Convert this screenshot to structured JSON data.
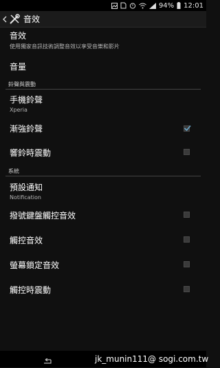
{
  "status_bar": {
    "battery_level": "94%",
    "time": "12:01"
  },
  "action_bar": {
    "title": "音效"
  },
  "items": [
    {
      "title": "音效",
      "subtitle": "使用獨家音訊技術調整音效以享受音樂和影片"
    },
    {
      "title": "音量"
    },
    {
      "section": "鈴聲與震動"
    },
    {
      "title": "手機鈴聲",
      "subtitle": "Xperia"
    },
    {
      "title": "漸強鈴聲",
      "checked": true
    },
    {
      "title": "響鈴時震動",
      "checked": false
    },
    {
      "section": "系統"
    },
    {
      "title": "預設通知",
      "subtitle": "Notification"
    },
    {
      "title": "撥號鍵盤觸控音效",
      "checked": false
    },
    {
      "title": "觸控音效",
      "checked": false
    },
    {
      "title": "螢幕鎖定音效",
      "checked": false
    },
    {
      "title": "觸控時震動",
      "checked": false
    }
  ],
  "watermark": "jk_munin111@ sogi.com.tw",
  "icons": [
    "back-icon",
    "wrench-screwdriver-icon",
    "checkmark-icon",
    "nav-back-icon"
  ],
  "colors": {
    "background": "#101010",
    "check_accent": "#6aa6c8"
  }
}
